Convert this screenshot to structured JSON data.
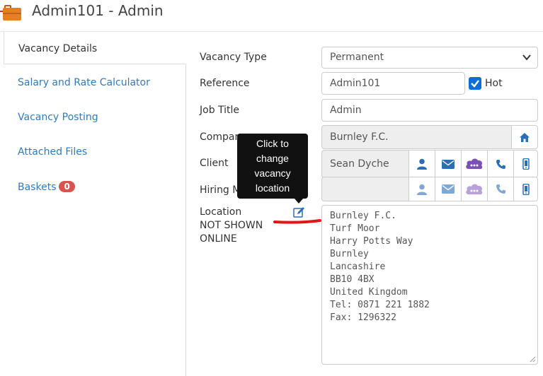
{
  "header": {
    "title": "Admin101 - Admin",
    "icon": "briefcase-icon"
  },
  "sidebar": {
    "items": [
      {
        "label": "Vacancy Details",
        "active": true
      },
      {
        "label": "Salary and Rate Calculator"
      },
      {
        "label": "Vacancy Posting"
      },
      {
        "label": "Attached Files"
      },
      {
        "label": "Baskets",
        "badge": "0"
      }
    ]
  },
  "form": {
    "vacancy_type": {
      "label": "Vacancy Type",
      "value": "Permanent"
    },
    "reference": {
      "label": "Reference",
      "value": "Admin101"
    },
    "hot": {
      "label": "Hot",
      "checked": true
    },
    "job_title": {
      "label": "Job Title",
      "value": "Admin"
    },
    "company": {
      "label": "Company",
      "value": "Burnley F.C."
    },
    "client": {
      "label": "Client",
      "value": "Sean Dyche"
    },
    "hiring_manager": {
      "label": "Hiring Ma",
      "value": ""
    },
    "location": {
      "label": "Location",
      "note_line1": "NOT SHOWN",
      "note_line2": "ONLINE",
      "address_lines": [
        "Burnley F.C.",
        "Turf Moor",
        "Harry Potts Way",
        "Burnley",
        "Lancashire",
        "BB10 4BX",
        "United Kingdom",
        "Tel: 0871 221 1882",
        "Fax: 1296322"
      ]
    }
  },
  "tooltip": {
    "lines": [
      "Click to",
      "change",
      "vacancy",
      "location"
    ]
  },
  "colors": {
    "link": "#337ab7",
    "badge": "#d9534f",
    "icon_blue": "#2a6eb5",
    "icon_purple": "#7b4fb3",
    "annotation": "#e3141b"
  }
}
